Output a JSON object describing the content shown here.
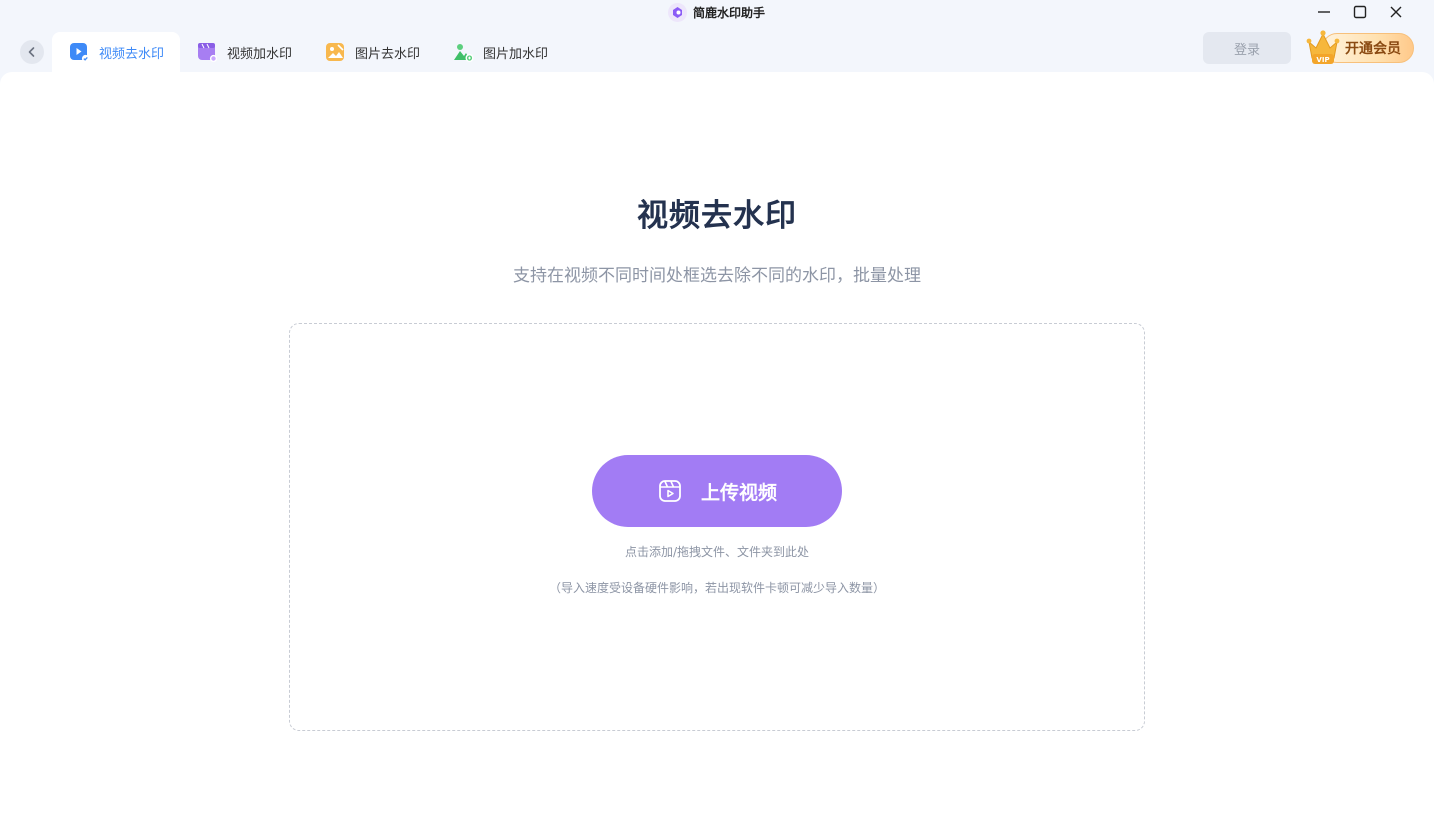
{
  "app": {
    "title": "简鹿水印助手"
  },
  "window_controls": [
    "minimize-icon",
    "maximize-icon",
    "close-icon"
  ],
  "tabs": [
    {
      "label": "视频去水印",
      "icon": "video-remove-watermark-icon",
      "active": true
    },
    {
      "label": "视频加水印",
      "icon": "video-add-watermark-icon",
      "active": false
    },
    {
      "label": "图片去水印",
      "icon": "image-remove-watermark-icon",
      "active": false
    },
    {
      "label": "图片加水印",
      "icon": "image-add-watermark-icon",
      "active": false
    }
  ],
  "header": {
    "login_label": "登录",
    "vip_label": "开通会员",
    "vip_badge": "VIP"
  },
  "main": {
    "title": "视频去水印",
    "subtitle": "支持在视频不同时间处框选去除不同的水印，批量处理",
    "upload_label": "上传视频",
    "hint_primary": "点击添加/拖拽文件、文件夹到此处",
    "hint_secondary": "（导入速度受设备硬件影响，若出现软件卡顿可减少导入数量）"
  },
  "colors": {
    "accent_blue": "#3e8af7",
    "upload_purple": "#a27cf4",
    "title_dark": "#24324f",
    "muted_text": "#8d95a5"
  }
}
